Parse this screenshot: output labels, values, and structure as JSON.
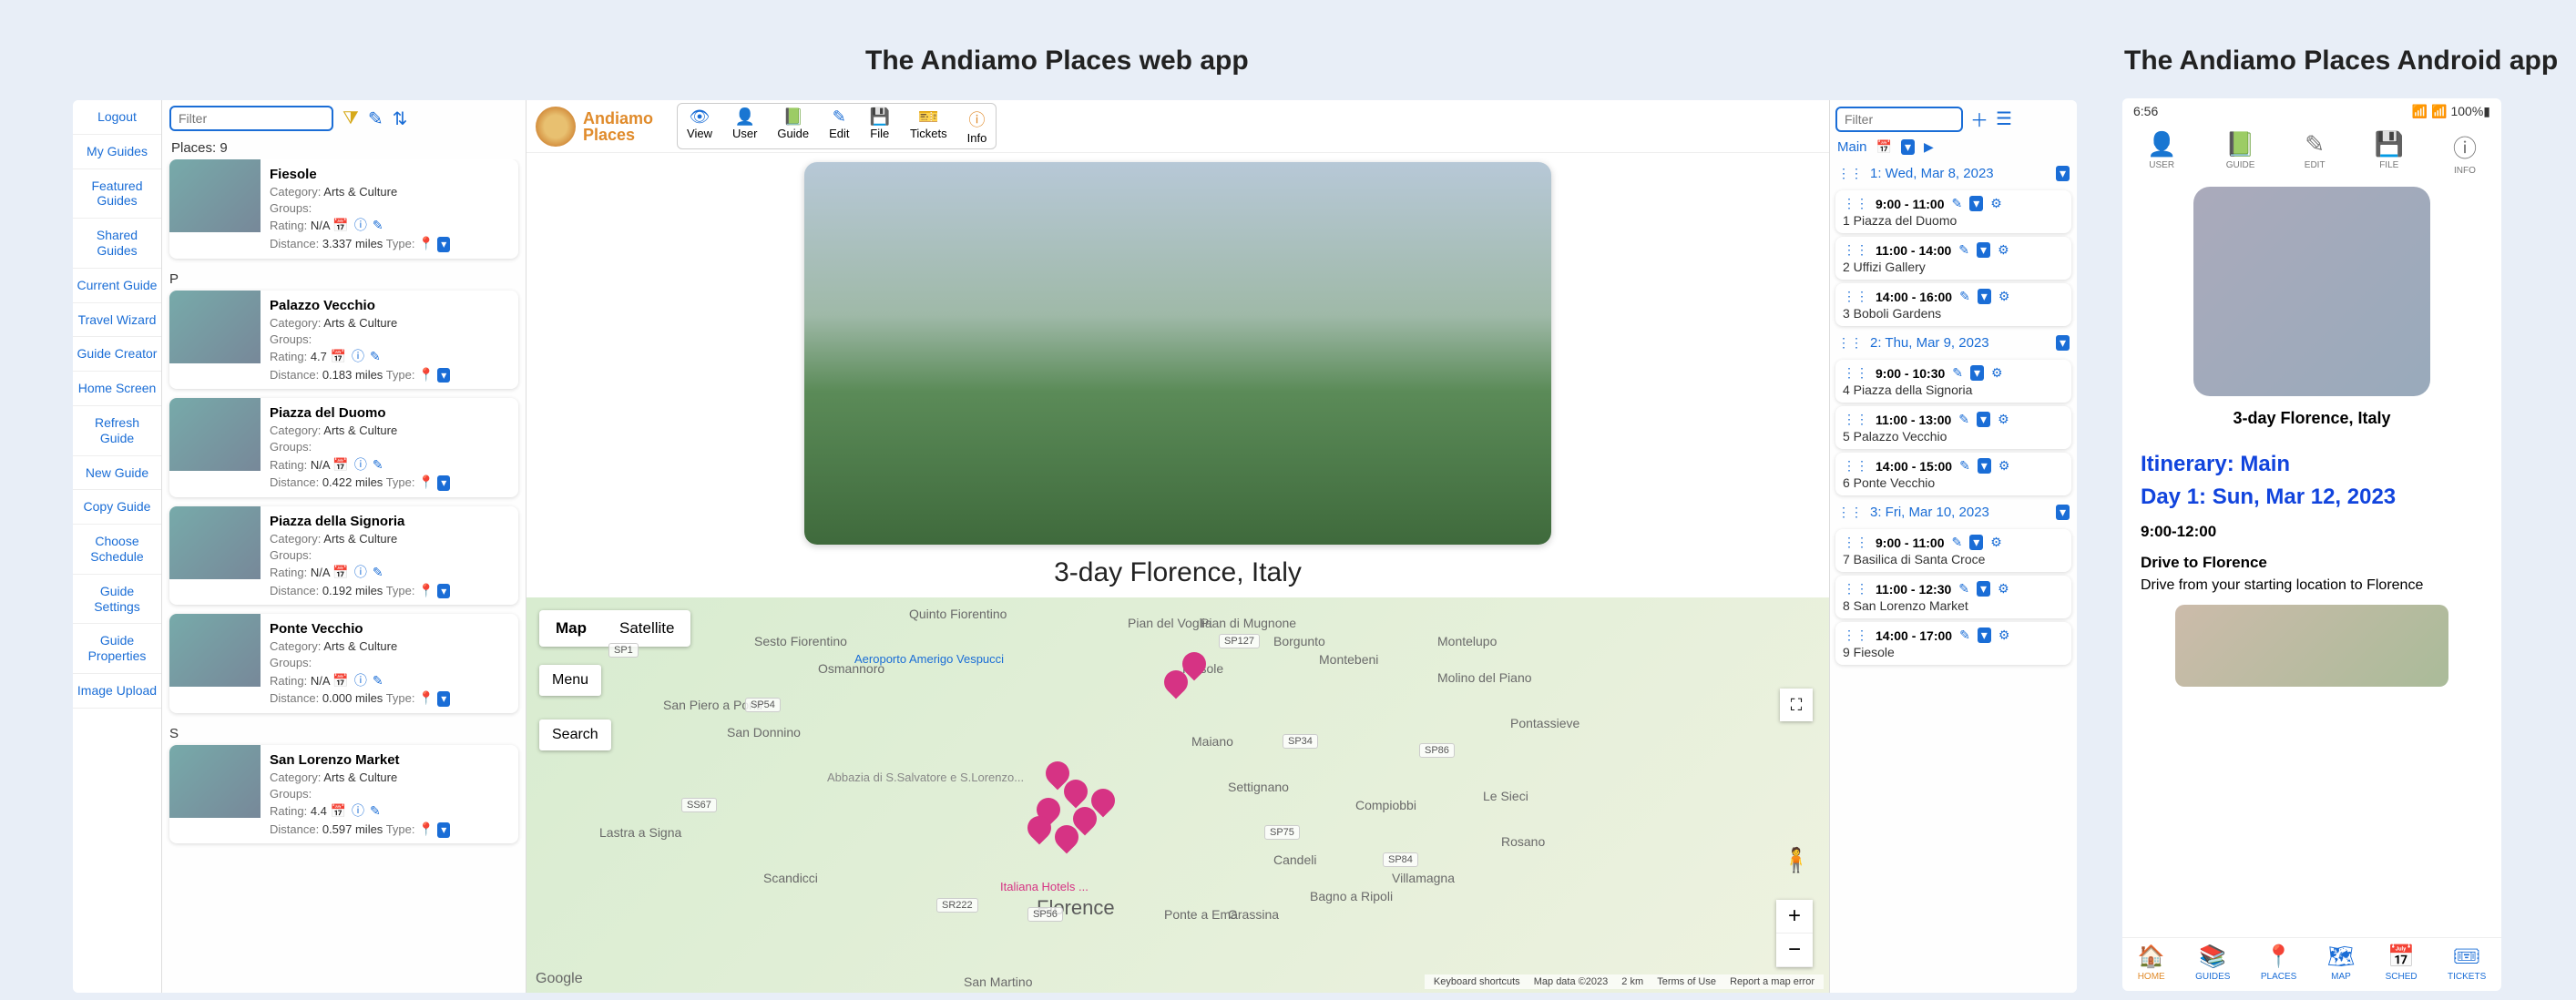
{
  "headings": {
    "web": "The Andiamo Places web app",
    "android": "The Andiamo Places Android app"
  },
  "leftnav": [
    "Logout",
    "My Guides",
    "Featured Guides",
    "Shared Guides",
    "Current Guide",
    "Travel Wizard",
    "Guide Creator",
    "Home Screen",
    "Refresh Guide",
    "New Guide",
    "Copy Guide",
    "Choose Schedule",
    "Guide Settings",
    "Guide Properties",
    "Image Upload"
  ],
  "places": {
    "filter_placeholder": "Filter",
    "count_label": "Places: 9",
    "items": [
      {
        "letter": "",
        "name": "Fiesole",
        "category": "Arts & Culture",
        "rating": "N/A",
        "distance": "3.337 miles"
      },
      {
        "letter": "P",
        "name": "Palazzo Vecchio",
        "category": "Arts & Culture",
        "rating": "4.7",
        "distance": "0.183 miles"
      },
      {
        "letter": "",
        "name": "Piazza del Duomo",
        "category": "Arts & Culture",
        "rating": "N/A",
        "distance": "0.422 miles"
      },
      {
        "letter": "",
        "name": "Piazza della Signoria",
        "category": "Arts & Culture",
        "rating": "N/A",
        "distance": "0.192 miles"
      },
      {
        "letter": "",
        "name": "Ponte Vecchio",
        "category": "Arts & Culture",
        "rating": "N/A",
        "distance": "0.000 miles"
      },
      {
        "letter": "S",
        "name": "San Lorenzo Market",
        "category": "Arts & Culture",
        "rating": "4.4",
        "distance": "0.597 miles"
      }
    ],
    "labels": {
      "category": "Category:",
      "groups": "Groups:",
      "rating": "Rating:",
      "distance": "Distance:",
      "type": "Type:"
    }
  },
  "brand": {
    "name1": "Andiamo",
    "name2": "Places"
  },
  "menus": [
    {
      "label": "View",
      "color": "ic-blue",
      "glyph": "👁"
    },
    {
      "label": "User",
      "color": "ic-green",
      "glyph": "👤"
    },
    {
      "label": "Guide",
      "color": "ic-green",
      "glyph": "📗"
    },
    {
      "label": "Edit",
      "color": "ic-blue",
      "glyph": "✎"
    },
    {
      "label": "File",
      "color": "ic-blue",
      "glyph": "💾"
    },
    {
      "label": "Tickets",
      "color": "ic-blue",
      "glyph": "🎫"
    },
    {
      "label": "Info",
      "color": "ic-orange",
      "glyph": "ⓘ"
    }
  ],
  "hero_title": "3-day Florence, Italy",
  "map": {
    "tabs": {
      "map": "Map",
      "satellite": "Satellite"
    },
    "menu": "Menu",
    "search": "Search",
    "florence": "Florence",
    "attrib": {
      "shortcuts": "Keyboard shortcuts",
      "data": "Map data ©2023",
      "scale": "2 km",
      "terms": "Terms of Use",
      "report": "Report a map error"
    },
    "google": "Google",
    "roads": [
      "SP1",
      "SP54",
      "SS67",
      "SR222",
      "SP56",
      "SP127",
      "SP34",
      "SP86",
      "SP75",
      "SP84"
    ],
    "towns": [
      "Quinto Fiorentino",
      "Sesto Fiorentino",
      "Osmannoro",
      "San Piero a Ponti",
      "San Donnino",
      "Lastra a Signa",
      "Scandicci",
      "Fiesole",
      "Settignano",
      "Maiano",
      "Pian di Mugnone",
      "Borgunto",
      "Montebeni",
      "Compiobbi",
      "Candeli",
      "Pontassieve",
      "Molino del Piano",
      "Montelupo",
      "Le Sieci",
      "Rosano",
      "Villamagna",
      "Bagno a Ripoli",
      "Grassina",
      "Ponte a Ema",
      "Pian del Voglia"
    ],
    "airport": "Aeroporto Amerigo Vespucci",
    "abbey": "Abbazia di S.Salvatore e S.Lorenzo...",
    "hotels": "Italiana Hotels ...",
    "sanmartino": "San Martino"
  },
  "schedule": {
    "filter_placeholder": "Filter",
    "main": "Main",
    "days": [
      {
        "label": "1: Wed, Mar 8, 2023",
        "items": [
          {
            "time": "9:00 - 11:00",
            "num": "1",
            "place": "Piazza del Duomo"
          },
          {
            "time": "11:00 - 14:00",
            "num": "2",
            "place": "Uffizi Gallery"
          },
          {
            "time": "14:00 - 16:00",
            "num": "3",
            "place": "Boboli Gardens"
          }
        ]
      },
      {
        "label": "2: Thu, Mar 9, 2023",
        "items": [
          {
            "time": "9:00 - 10:30",
            "num": "4",
            "place": "Piazza della Signoria"
          },
          {
            "time": "11:00 - 13:00",
            "num": "5",
            "place": "Palazzo Vecchio"
          },
          {
            "time": "14:00 - 15:00",
            "num": "6",
            "place": "Ponte Vecchio"
          }
        ]
      },
      {
        "label": "3: Fri, Mar 10, 2023",
        "items": [
          {
            "time": "9:00 - 11:00",
            "num": "7",
            "place": "Basilica di Santa Croce"
          },
          {
            "time": "11:00 - 12:30",
            "num": "8",
            "place": "San Lorenzo Market"
          },
          {
            "time": "14:00 - 17:00",
            "num": "9",
            "place": "Fiesole"
          }
        ]
      }
    ]
  },
  "phone": {
    "time": "6:56",
    "battery": "100%",
    "top": [
      {
        "label": "USER",
        "glyph": "👤",
        "color": "ic-green"
      },
      {
        "label": "GUIDE",
        "glyph": "📗",
        "color": "ic-green"
      },
      {
        "label": "EDIT",
        "glyph": "✎",
        "color": ""
      },
      {
        "label": "FILE",
        "glyph": "💾",
        "color": ""
      },
      {
        "label": "INFO",
        "glyph": "ⓘ",
        "color": ""
      }
    ],
    "title": "3-day Florence, Italy",
    "itin": "Itinerary: Main",
    "day": "Day 1: Sun, Mar 12, 2023",
    "slot": "9:00-12:00",
    "activity": "Drive to Florence",
    "desc": "Drive from your starting location to Florence",
    "bottom": [
      {
        "label": "HOME",
        "glyph": "🏠",
        "cls": "pb-orange"
      },
      {
        "label": "GUIDES",
        "glyph": "📚",
        "cls": "pb-blue"
      },
      {
        "label": "PLACES",
        "glyph": "📍",
        "cls": "pb-blue"
      },
      {
        "label": "MAP",
        "glyph": "🗺",
        "cls": "pb-blue"
      },
      {
        "label": "SCHED",
        "glyph": "📅",
        "cls": "pb-blue"
      },
      {
        "label": "TICKETS",
        "glyph": "🎟",
        "cls": "pb-blue"
      }
    ]
  }
}
